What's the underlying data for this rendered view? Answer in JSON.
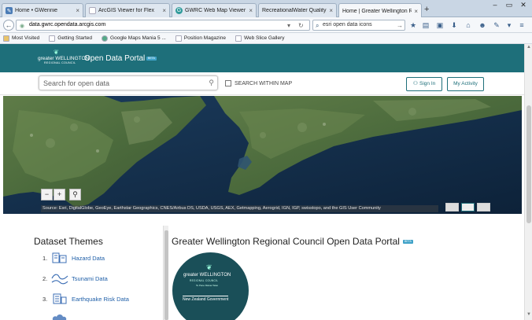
{
  "browser": {
    "tabs": [
      {
        "label": "Home • GWennie",
        "icon": "feather-icon"
      },
      {
        "label": "ArcGIS Viewer for Flex",
        "icon": "page-icon"
      },
      {
        "label": "GWRC Web Map Viewer",
        "icon": "globe-icon"
      },
      {
        "label": "RecreationalWater Quality Map",
        "icon": "page-icon"
      },
      {
        "label": "Home | Greater Wellington Reg...",
        "icon": "page-icon",
        "active": true
      }
    ],
    "new_tab": "+",
    "url_host": "data.gwrc.opendata.arcgis.com",
    "search_value": "esri open data icons",
    "bookmarks": [
      "Most Visited",
      "Getting Started",
      "Google Maps Mania 5 ...",
      "Position Magazine",
      "Web Slice Gallery"
    ]
  },
  "portal": {
    "logo_line1": "greater WELLINGTON",
    "logo_line2": "REGIONAL COUNCIL",
    "title": "Open Data Portal",
    "beta": "BETA",
    "search_placeholder": "Search for open data",
    "within_map": "SEARCH WITHIN MAP",
    "sign_in": "Sign In",
    "my_activity": "My Activity"
  },
  "map": {
    "zoom_out": "−",
    "zoom_in": "+",
    "attribution": "Source: Esri, DigitalGlobe, GeoEye, Earthstar Geographics, CNES/Airbus DS, USDA, USGS, AEX, Getmapping, Aerogrid, IGN, IGP, swisstopo, and the GIS User Community"
  },
  "themes": {
    "title": "Dataset Themes",
    "items": [
      {
        "num": "1.",
        "label": "Hazard Data"
      },
      {
        "num": "2.",
        "label": "Tsunami Data"
      },
      {
        "num": "3.",
        "label": "Earthquake Risk Data"
      }
    ]
  },
  "main": {
    "heading": "Greater Wellington Regional Council Open Data Portal",
    "beta": "BETA",
    "circle_line1": "greater WELLINGTON",
    "circle_line2": "REGIONAL COUNCIL",
    "circle_line3": "Te Pane Matua Taiao",
    "circle_line4": "New Zealand Government"
  },
  "colors": {
    "header": "#1e6f7a",
    "link": "#1f5fa8",
    "accent": "#3fa2c8"
  }
}
